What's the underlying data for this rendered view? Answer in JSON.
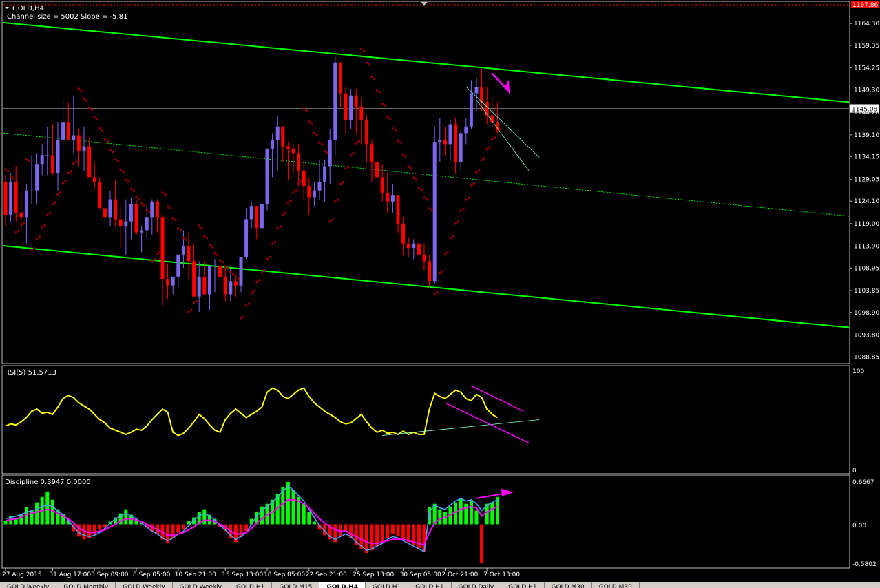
{
  "main": {
    "symbol": "GOLD,H4",
    "channel_info": "Channel size = 5002 Slope = -5.81",
    "price_labels": [
      "1164.30",
      "1159.35",
      "1154.25",
      "1149.30",
      "1144.20",
      "1139.10",
      "1134.15",
      "1129.05",
      "1124.10",
      "1119.00",
      "1113.90",
      "1108.95",
      "1103.85",
      "1098.90",
      "1093.80",
      "1088.85"
    ],
    "price_label_values": [
      1164.3,
      1159.35,
      1154.25,
      1149.3,
      1144.2,
      1139.1,
      1134.15,
      1129.05,
      1124.1,
      1119.0,
      1113.9,
      1108.95,
      1103.85,
      1098.9,
      1093.8,
      1088.85
    ],
    "top_price": "1167.86",
    "current_price": "1145.08",
    "current_price_value": 1145.08,
    "ylim": [
      1087.5,
      1169.0
    ]
  },
  "rsi": {
    "label": "RSI(5) 51.5713",
    "scale_top": "100",
    "scale_bottom": "0"
  },
  "discipline": {
    "label": "Discipline 0.3947 0.0000",
    "scale": [
      "0.6667",
      "0.00",
      "-0.5802"
    ]
  },
  "time_axis": [
    "27 Aug 2015",
    "31 Aug 17:00",
    "3 Sep 09:00",
    "8 Sep 05:00",
    "10 Sep 21:00",
    "15 Sep 13:00",
    "18 Sep 05:00",
    "22 Sep 21:00",
    "25 Sep 13:00",
    "30 Sep 05:00",
    "2 Oct 21:00",
    "7 Oct 13:00"
  ],
  "tabs": [
    {
      "label": "GOLD,Weekly",
      "active": false
    },
    {
      "label": "GOLD,Monthly",
      "active": false
    },
    {
      "label": "GOLD,Weekly",
      "active": false
    },
    {
      "label": "GOLD,Weekly",
      "active": false
    },
    {
      "label": "GOLD,H1",
      "active": false
    },
    {
      "label": "GOLD,M15",
      "active": false
    },
    {
      "label": "GOLD,H4",
      "active": true
    },
    {
      "label": "GOLD,H1",
      "active": false
    },
    {
      "label": "GOLD,H1",
      "active": false
    },
    {
      "label": "GOLD,Daily",
      "active": false
    },
    {
      "label": "GOLD,H1",
      "active": false
    },
    {
      "label": "GOLD,M30",
      "active": false
    },
    {
      "label": "GOLD,M30",
      "active": false
    }
  ],
  "colors": {
    "background": "#000000",
    "bull": "#7b68ee",
    "bear": "#ff0000",
    "channel": "#00ff00",
    "psar": "#8b0000",
    "rsi": "#ffff00",
    "trend_annotation": "#ff00ff",
    "cyan_line": "#7fffd4",
    "hist_pos": "#00ff00",
    "hist_neg": "#ff0000",
    "signal_blue": "#4f9dff",
    "signal_magenta": "#ff00ff"
  },
  "chart_data": {
    "type": "candlestick",
    "ohlc": [
      [
        1128.5,
        1130.0,
        1118.5,
        1121.0
      ],
      [
        1121.0,
        1130.5,
        1119.5,
        1128.5
      ],
      [
        1128.5,
        1132.0,
        1119.5,
        1121.5
      ],
      [
        1121.5,
        1125.5,
        1117.5,
        1120.5
      ],
      [
        1120.5,
        1128.0,
        1114.5,
        1126.5
      ],
      [
        1126.5,
        1134.5,
        1123.5,
        1126.5
      ],
      [
        1126.5,
        1135.0,
        1123.5,
        1132.5
      ],
      [
        1132.5,
        1137.0,
        1130.0,
        1134.5
      ],
      [
        1134.5,
        1141.0,
        1130.0,
        1134.5
      ],
      [
        1134.5,
        1141.5,
        1130.0,
        1130.5
      ],
      [
        1130.5,
        1142.0,
        1126.5,
        1138.0
      ],
      [
        1138.0,
        1147.0,
        1133.5,
        1142.0
      ],
      [
        1142.0,
        1146.5,
        1138.5,
        1138.0
      ],
      [
        1138.0,
        1148.0,
        1135.0,
        1139.0
      ],
      [
        1139.0,
        1140.5,
        1132.0,
        1135.5
      ],
      [
        1135.5,
        1141.0,
        1131.0,
        1136.5
      ],
      [
        1136.5,
        1138.5,
        1130.0,
        1129.5
      ],
      [
        1129.5,
        1133.0,
        1127.0,
        1128.5
      ],
      [
        1128.5,
        1129.5,
        1122.5,
        1122.5
      ],
      [
        1122.5,
        1128.0,
        1119.0,
        1120.5
      ],
      [
        1120.5,
        1126.5,
        1118.5,
        1124.5
      ],
      [
        1124.5,
        1129.0,
        1118.5,
        1120.0
      ],
      [
        1120.0,
        1123.5,
        1113.5,
        1118.5
      ],
      [
        1118.5,
        1124.5,
        1112.0,
        1119.5
      ],
      [
        1119.5,
        1125.0,
        1115.5,
        1123.5
      ],
      [
        1123.5,
        1124.5,
        1116.5,
        1117.0
      ],
      [
        1117.0,
        1118.5,
        1112.5,
        1117.5
      ],
      [
        1117.5,
        1123.0,
        1115.5,
        1120.5
      ],
      [
        1120.5,
        1124.5,
        1116.5,
        1124.0
      ],
      [
        1124.0,
        1124.5,
        1117.0,
        1120.5
      ],
      [
        1120.5,
        1121.0,
        1100.5,
        1106.5
      ],
      [
        1106.5,
        1110.0,
        1102.0,
        1105.0
      ],
      [
        1105.0,
        1106.0,
        1103.0,
        1107.0
      ],
      [
        1107.0,
        1109.0,
        1104.5,
        1112.0
      ],
      [
        1112.0,
        1117.5,
        1109.0,
        1114.0
      ],
      [
        1114.0,
        1117.0,
        1106.5,
        1110.5
      ],
      [
        1110.5,
        1114.5,
        1105.0,
        1102.5
      ],
      [
        1102.5,
        1110.5,
        1099.0,
        1107.0
      ],
      [
        1107.0,
        1110.5,
        1103.5,
        1103.0
      ],
      [
        1103.0,
        1108.5,
        1099.5,
        1109.5
      ],
      [
        1109.5,
        1111.0,
        1103.5,
        1109.5
      ],
      [
        1109.5,
        1108.5,
        1105.0,
        1107.0
      ],
      [
        1107.0,
        1109.0,
        1101.5,
        1103.0
      ],
      [
        1103.0,
        1109.0,
        1101.5,
        1106.0
      ],
      [
        1106.0,
        1107.5,
        1102.5,
        1105.0
      ],
      [
        1105.0,
        1108.5,
        1103.5,
        1111.5
      ],
      [
        1111.5,
        1122.5,
        1111.0,
        1120.0
      ],
      [
        1120.0,
        1124.0,
        1118.0,
        1123.0
      ],
      [
        1123.0,
        1121.0,
        1115.5,
        1118.0
      ],
      [
        1118.0,
        1124.5,
        1117.0,
        1123.5
      ],
      [
        1123.5,
        1133.0,
        1122.0,
        1136.0
      ],
      [
        1136.0,
        1139.5,
        1129.5,
        1138.0
      ],
      [
        1138.0,
        1143.5,
        1131.0,
        1141.0
      ],
      [
        1141.0,
        1141.0,
        1133.0,
        1136.5
      ],
      [
        1136.5,
        1137.5,
        1129.0,
        1136.0
      ],
      [
        1136.0,
        1137.0,
        1130.5,
        1135.0
      ],
      [
        1135.0,
        1137.0,
        1127.5,
        1131.0
      ],
      [
        1131.0,
        1133.5,
        1124.5,
        1127.5
      ],
      [
        1127.5,
        1129.5,
        1121.0,
        1125.0
      ],
      [
        1125.0,
        1128.5,
        1123.0,
        1126.5
      ],
      [
        1126.5,
        1133.5,
        1124.5,
        1128.5
      ],
      [
        1128.5,
        1133.5,
        1124.0,
        1132.0
      ],
      [
        1132.0,
        1140.5,
        1128.0,
        1138.0
      ],
      [
        1138.0,
        1157.0,
        1134.5,
        1155.5
      ],
      [
        1155.5,
        1154.5,
        1145.5,
        1148.5
      ],
      [
        1148.5,
        1150.0,
        1139.5,
        1142.5
      ],
      [
        1142.5,
        1149.5,
        1140.5,
        1148.0
      ],
      [
        1148.0,
        1149.5,
        1139.5,
        1145.5
      ],
      [
        1145.5,
        1147.5,
        1137.0,
        1142.5
      ],
      [
        1142.5,
        1143.5,
        1133.0,
        1137.0
      ],
      [
        1137.0,
        1138.0,
        1128.5,
        1133.0
      ],
      [
        1133.0,
        1134.5,
        1127.0,
        1129.5
      ],
      [
        1129.5,
        1132.5,
        1124.0,
        1126.0
      ],
      [
        1126.0,
        1130.5,
        1121.5,
        1124.0
      ],
      [
        1124.0,
        1128.0,
        1121.5,
        1125.5
      ],
      [
        1125.5,
        1122.0,
        1117.0,
        1119.0
      ],
      [
        1119.0,
        1120.5,
        1112.0,
        1114.5
      ],
      [
        1114.5,
        1116.0,
        1111.5,
        1113.5
      ],
      [
        1113.5,
        1115.5,
        1111.0,
        1114.5
      ],
      [
        1114.5,
        1116.5,
        1110.5,
        1112.0
      ],
      [
        1112.0,
        1114.5,
        1108.5,
        1110.5
      ],
      [
        1110.5,
        1112.0,
        1104.5,
        1106.0
      ],
      [
        1106.0,
        1141.0,
        1105.5,
        1137.5
      ],
      [
        1137.5,
        1143.0,
        1133.0,
        1138.0
      ],
      [
        1138.0,
        1141.0,
        1134.5,
        1137.0
      ],
      [
        1137.0,
        1142.5,
        1133.5,
        1141.5
      ],
      [
        1141.5,
        1143.0,
        1130.5,
        1133.0
      ],
      [
        1133.0,
        1140.0,
        1131.0,
        1139.5
      ],
      [
        1139.5,
        1143.0,
        1137.0,
        1141.0
      ],
      [
        1141.0,
        1151.5,
        1140.5,
        1148.5
      ],
      [
        1148.5,
        1152.0,
        1144.5,
        1150.0
      ],
      [
        1150.0,
        1154.0,
        1144.5,
        1146.5
      ],
      [
        1146.5,
        1150.0,
        1141.5,
        1143.5
      ],
      [
        1143.5,
        1147.5,
        1140.5,
        1142.0
      ],
      [
        1142.0,
        1146.5,
        1139.5,
        1140.0
      ]
    ],
    "channel_upper": [
      1164.5,
      1146.5
    ],
    "channel_mid": [
      1139.5,
      1120.7
    ],
    "channel_lower": [
      1114.0,
      1095.5
    ],
    "rsi_values": [
      44,
      46,
      45,
      48,
      52,
      58,
      60,
      56,
      57,
      55,
      62,
      70,
      73,
      71,
      66,
      63,
      60,
      55,
      50,
      47,
      42,
      40,
      38,
      36,
      38,
      41,
      40,
      44,
      50,
      55,
      60,
      57,
      38,
      35,
      37,
      42,
      48,
      55,
      51,
      45,
      40,
      38,
      50,
      56,
      60,
      56,
      52,
      55,
      58,
      62,
      76,
      80,
      78,
      72,
      70,
      74,
      78,
      80,
      72,
      66,
      62,
      58,
      55,
      52,
      48,
      46,
      47,
      51,
      55,
      48,
      42,
      38,
      40,
      37,
      38,
      36,
      39,
      36,
      38,
      36,
      36,
      60,
      75,
      72,
      70,
      74,
      78,
      76,
      70,
      68,
      74,
      71,
      60,
      55,
      52
    ],
    "rsi_ylim": [
      0,
      100
    ],
    "discipline_hist": [
      0.05,
      0.12,
      0.08,
      0.15,
      0.25,
      0.2,
      0.32,
      0.4,
      0.48,
      0.36,
      0.22,
      0.15,
      0.06,
      -0.1,
      -0.18,
      -0.22,
      -0.2,
      -0.15,
      -0.08,
      -0.05,
      0.04,
      0.1,
      0.16,
      0.22,
      0.14,
      0.08,
      0.02,
      -0.05,
      -0.1,
      -0.15,
      -0.22,
      -0.28,
      -0.2,
      -0.12,
      -0.08,
      0.05,
      0.1,
      0.18,
      0.22,
      0.14,
      0.08,
      -0.04,
      -0.1,
      -0.2,
      -0.26,
      -0.18,
      -0.1,
      0.08,
      0.18,
      0.26,
      0.3,
      0.36,
      0.44,
      0.55,
      0.62,
      0.5,
      0.4,
      0.3,
      0.18,
      0.04,
      -0.08,
      -0.16,
      -0.22,
      -0.26,
      -0.18,
      -0.1,
      -0.2,
      -0.3,
      -0.36,
      -0.42,
      -0.38,
      -0.32,
      -0.28,
      -0.2,
      -0.14,
      -0.18,
      -0.22,
      -0.26,
      -0.3,
      -0.35,
      -0.4,
      0.25,
      0.3,
      0.22,
      0.18,
      0.26,
      0.32,
      0.38,
      0.3,
      0.35,
      0.2,
      -0.56,
      0.3,
      0.32,
      0.4
    ],
    "discipline_signal_a": [
      0.05,
      0.07,
      0.08,
      0.1,
      0.14,
      0.16,
      0.18,
      0.2,
      0.22,
      0.2,
      0.16,
      0.12,
      0.08,
      0.02,
      -0.05,
      -0.1,
      -0.12,
      -0.12,
      -0.1,
      -0.08,
      -0.04,
      0.0,
      0.05,
      0.08,
      0.08,
      0.06,
      0.04,
      0.0,
      -0.04,
      -0.08,
      -0.12,
      -0.16,
      -0.16,
      -0.14,
      -0.12,
      -0.08,
      -0.04,
      0.02,
      0.06,
      0.06,
      0.04,
      0.0,
      -0.04,
      -0.1,
      -0.14,
      -0.14,
      -0.12,
      -0.06,
      0.02,
      0.08,
      0.14,
      0.18,
      0.24,
      0.3,
      0.36,
      0.36,
      0.34,
      0.3,
      0.24,
      0.16,
      0.08,
      0.02,
      -0.04,
      -0.08,
      -0.1,
      -0.1,
      -0.14,
      -0.18,
      -0.22,
      -0.26,
      -0.28,
      -0.28,
      -0.26,
      -0.24,
      -0.22,
      -0.22,
      -0.22,
      -0.24,
      -0.26,
      -0.28,
      -0.3,
      -0.12,
      0.02,
      0.08,
      0.1,
      0.14,
      0.18,
      0.22,
      0.24,
      0.26,
      0.24,
      0.12,
      0.18,
      0.22,
      0.26
    ],
    "discipline_signal_b": [
      0.08,
      0.1,
      0.12,
      0.14,
      0.18,
      0.2,
      0.22,
      0.26,
      0.28,
      0.26,
      0.2,
      0.14,
      0.06,
      -0.04,
      -0.12,
      -0.16,
      -0.18,
      -0.16,
      -0.12,
      -0.06,
      0.02,
      0.08,
      0.12,
      0.16,
      0.12,
      0.08,
      0.02,
      -0.04,
      -0.1,
      -0.14,
      -0.2,
      -0.24,
      -0.2,
      -0.14,
      -0.1,
      -0.02,
      0.06,
      0.12,
      0.16,
      0.12,
      0.06,
      -0.02,
      -0.08,
      -0.16,
      -0.22,
      -0.18,
      -0.12,
      0.0,
      0.12,
      0.2,
      0.26,
      0.32,
      0.4,
      0.48,
      0.56,
      0.5,
      0.42,
      0.34,
      0.22,
      0.1,
      -0.02,
      -0.1,
      -0.18,
      -0.22,
      -0.18,
      -0.14,
      -0.18,
      -0.26,
      -0.32,
      -0.38,
      -0.36,
      -0.32,
      -0.28,
      -0.22,
      -0.18,
      -0.2,
      -0.24,
      -0.28,
      -0.32,
      -0.36,
      -0.4,
      0.18,
      0.28,
      0.24,
      0.22,
      0.28,
      0.34,
      0.38,
      0.34,
      0.36,
      0.3,
      0.2,
      0.28,
      0.32,
      0.36
    ],
    "discipline_ylim": [
      -0.62,
      0.7
    ],
    "title": "",
    "xlabel": "",
    "ylabel": ""
  }
}
